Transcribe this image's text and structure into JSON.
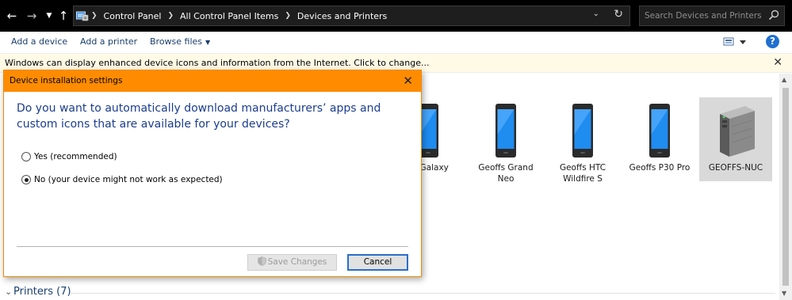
{
  "address_bar": {
    "breadcrumbs": [
      "Control Panel",
      "All Control Panel Items",
      "Devices and Printers"
    ],
    "search_placeholder": "Search Devices and Printers"
  },
  "toolbar": {
    "add_device": "Add a device",
    "add_printer": "Add a printer",
    "browse_files": "Browse files"
  },
  "info_bar": {
    "text": "Windows can display enhanced device icons and information from the Internet. Click to change..."
  },
  "devices": [
    {
      "label": "Geoffs Galaxy",
      "visible_label": "f's Galaxy"
    },
    {
      "label": "Geoffs Grand Neo"
    },
    {
      "label": "Geoffs HTC Wildfire S"
    },
    {
      "label": "Geoffs P30 Pro"
    },
    {
      "label": "GEOFFS-NUC",
      "selected": true
    }
  ],
  "sections": {
    "printers": "Printers (7)"
  },
  "dialog": {
    "title": "Device installation settings",
    "question": "Do you want to automatically download manufacturers’ apps and custom icons that are available for your devices?",
    "options": [
      {
        "label": "Yes (recommended)",
        "selected": false
      },
      {
        "label": "No (your device might not work as expected)",
        "selected": true
      }
    ],
    "save_label": "Save Changes",
    "cancel_label": "Cancel"
  },
  "colors": {
    "dialog_title_bar": "#ff8c00",
    "info_bar_bg": "#fffae6",
    "link_blue": "#1a3e6e",
    "question_blue": "#1b3d8f"
  }
}
